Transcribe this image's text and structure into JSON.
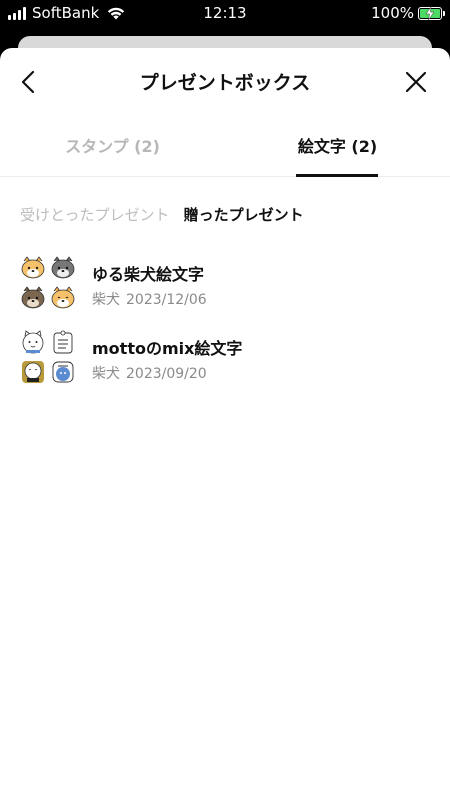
{
  "status_bar": {
    "carrier": "SoftBank",
    "time": "12:13",
    "battery": "100%",
    "battery_color": "#4cd964"
  },
  "header": {
    "title": "プレゼントボックス",
    "back_icon": "chevron-left-icon",
    "close_icon": "close-icon"
  },
  "tabs": [
    {
      "label": "スタンプ (2)",
      "active": false
    },
    {
      "label": "絵文字 (2)",
      "active": true
    }
  ],
  "subtabs": [
    {
      "label": "受けとったプレゼント",
      "active": false
    },
    {
      "label": "贈ったプレゼント",
      "active": true
    }
  ],
  "items": [
    {
      "title": "ゆる柴犬絵文字",
      "recipient": "柴犬",
      "date": "2023/12/06",
      "icons": [
        "shiba-dog-emoji-icon",
        "gray-dog-emoji-icon",
        "brown-dog-emoji-icon",
        "shiba-dog-emoji-icon"
      ]
    },
    {
      "title": "mottoのmix絵文字",
      "recipient": "柴犬",
      "date": "2023/09/20",
      "icons": [
        "cat-emoji-icon",
        "sign-emoji-icon",
        "circle-emoji-icon",
        "badge-emoji-icon"
      ]
    }
  ]
}
